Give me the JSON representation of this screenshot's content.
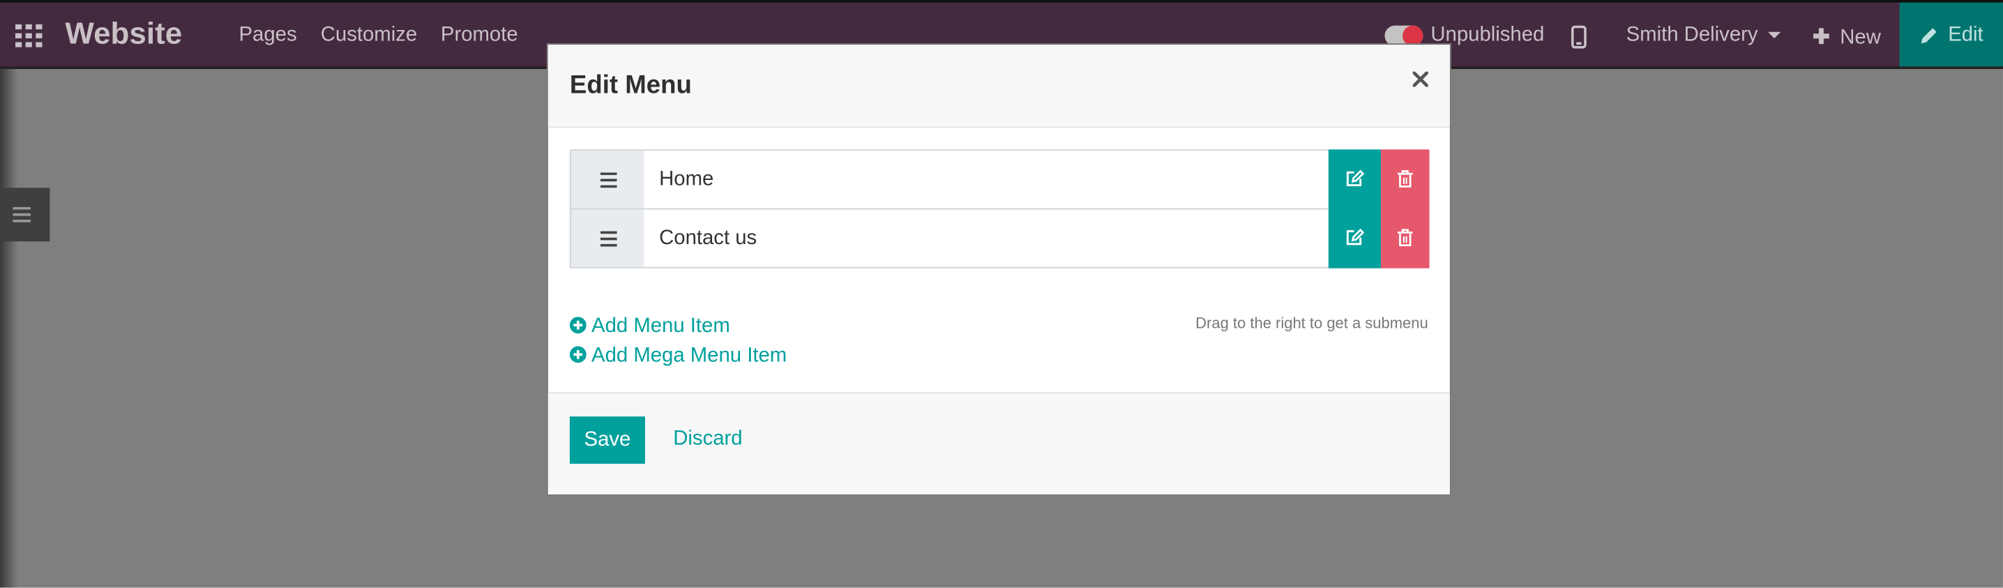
{
  "navbar": {
    "brand": "Website",
    "menus": [
      "Pages",
      "Customize",
      "Promote"
    ],
    "publish_status": "Unpublished",
    "website_name": "Smith Delivery",
    "new_label": "New",
    "edit_label": "Edit"
  },
  "modal": {
    "title": "Edit Menu",
    "items": [
      {
        "label": "Home"
      },
      {
        "label": "Contact us"
      }
    ],
    "add_menu_item": "Add Menu Item",
    "add_mega_menu_item": "Add Mega Menu Item",
    "hint": "Drag to the right to get a submenu",
    "save_label": "Save",
    "discard_label": "Discard"
  },
  "colors": {
    "navbar_bg": "#442a3e",
    "accent": "#00a09d",
    "danger": "#e6586c",
    "edit_btn_bg": "#00756f",
    "backdrop": "#7f7f7f"
  },
  "icons": [
    "apps-icon",
    "mobile-icon",
    "pencil-icon",
    "hamburger-icon",
    "close-icon",
    "drag-handle-icon",
    "edit-icon",
    "trash-icon",
    "plus-circle-icon"
  ]
}
